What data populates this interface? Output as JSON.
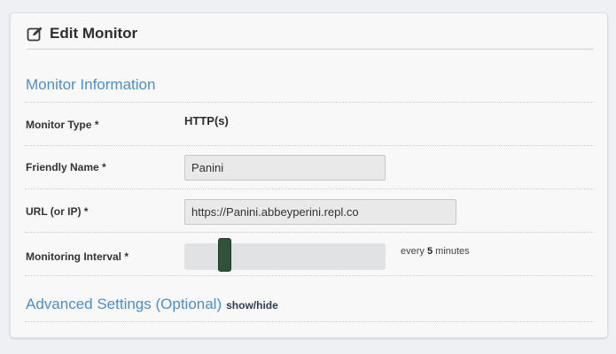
{
  "panel": {
    "title": "Edit Monitor",
    "icon": "edit-icon"
  },
  "monitor_information": {
    "title": "Monitor Information",
    "monitor_type": {
      "label": "Monitor Type *",
      "value": "HTTP(s)"
    },
    "friendly_name": {
      "label": "Friendly Name *",
      "value": "Panini"
    },
    "url": {
      "label": "URL (or IP) *",
      "value": "https://Panini.abbeyperini.repl.co"
    },
    "monitoring_interval": {
      "label": "Monitoring Interval *",
      "prefix": "every",
      "value": "5",
      "unit": "minutes",
      "slider_fraction": 0.18
    }
  },
  "advanced_settings": {
    "title": "Advanced Settings (Optional)",
    "toggle_label": "show/hide"
  },
  "colors": {
    "section_title": "#4a8fca",
    "slider_handle": "#325238"
  }
}
